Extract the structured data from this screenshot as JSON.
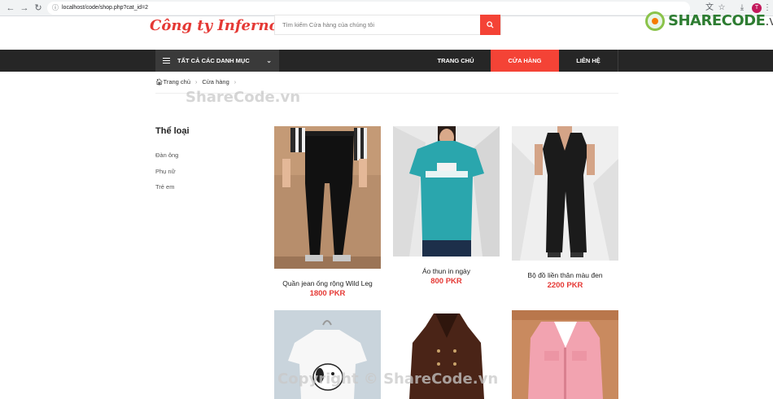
{
  "browser": {
    "url": "localhost/code/shop.php?cat_id=2",
    "profile_initial": "T"
  },
  "watermark": {
    "logo_text": "SHARECODE",
    "logo_suffix": ".vn",
    "center_text": "ShareCode.vn",
    "bottom_text": "Copyright © ShareCode.vn"
  },
  "header": {
    "brand": "Công ty Inferno",
    "search_placeholder": "Tìm kiếm Cửa hàng của chúng tôi"
  },
  "nav": {
    "categories_label": "TẤT CẢ CÁC DANH MỤC",
    "items": [
      {
        "label": "TRANG CHỦ",
        "active": false
      },
      {
        "label": "CỬA HÀNG",
        "active": true
      },
      {
        "label": "LIÊN HỆ",
        "active": false
      }
    ]
  },
  "breadcrumb": {
    "home": "Trang chủ",
    "current": "Cửa hàng"
  },
  "sidebar": {
    "title": "Thể loại",
    "items": [
      "Đàn ông",
      "Phụ nữ",
      "Trẻ em"
    ]
  },
  "products": [
    {
      "name": "Quần jean ống rộng Wild Leg",
      "price": "1800 PKR"
    },
    {
      "name": "Áo thun in ngày",
      "price": "800 PKR"
    },
    {
      "name": "Bộ đồ liền thân màu đen",
      "price": "2200 PKR"
    }
  ],
  "colors": {
    "accent": "#f44336",
    "nav_bg": "#262626",
    "price": "#e53935"
  }
}
